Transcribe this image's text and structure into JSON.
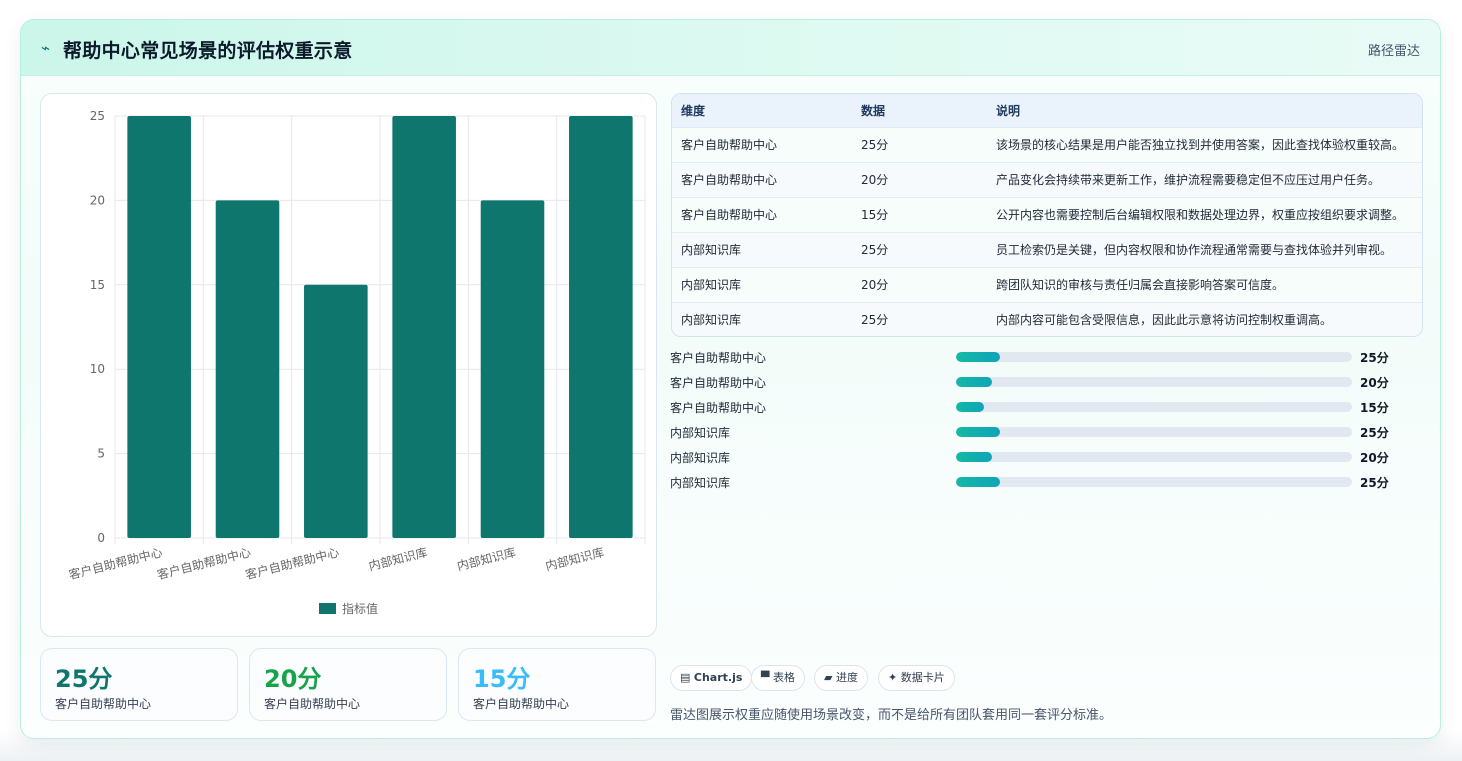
{
  "header": {
    "icon": "spark-icon",
    "title": "帮助中心常见场景的评估权重示意",
    "tag": "路径雷达"
  },
  "colors": {
    "bar": "#0f766e",
    "accent_green": "#16a34a",
    "accent_teal": "#0f766e",
    "accent_blue": "#38bdf8"
  },
  "chart_data": {
    "type": "bar",
    "categories": [
      "客户自助帮助中心",
      "客户自助帮助中心",
      "客户自助帮助中心",
      "内部知识库",
      "内部知识库",
      "内部知识库"
    ],
    "series": [
      {
        "name": "指标值",
        "values": [
          25,
          20,
          15,
          25,
          20,
          25
        ]
      }
    ],
    "ylim": [
      0,
      25
    ],
    "yticks": [
      0,
      5,
      10,
      15,
      20,
      25
    ],
    "grid": true,
    "legend": "bottom"
  },
  "table": {
    "headers": [
      "维度",
      "数据",
      "说明"
    ],
    "rows": [
      [
        "客户自助帮助中心",
        "25分",
        "该场景的核心结果是用户能否独立找到并使用答案，因此查找体验权重较高。"
      ],
      [
        "客户自助帮助中心",
        "20分",
        "产品变化会持续带来更新工作，维护流程需要稳定但不应压过用户任务。"
      ],
      [
        "客户自助帮助中心",
        "15分",
        "公开内容也需要控制后台编辑权限和数据处理边界，权重应按组织要求调整。"
      ],
      [
        "内部知识库",
        "25分",
        "员工检索仍是关键，但内容权限和协作流程通常需要与查找体验并列审视。"
      ],
      [
        "内部知识库",
        "20分",
        "跨团队知识的审核与责任归属会直接影响答案可信度。"
      ],
      [
        "内部知识库",
        "25分",
        "内部内容可能包含受限信息，因此此示意将访问控制权重调高。"
      ]
    ]
  },
  "progress": [
    {
      "label": "客户自助帮助中心",
      "value": "25分",
      "fraction": 0.11
    },
    {
      "label": "客户自助帮助中心",
      "value": "20分",
      "fraction": 0.09
    },
    {
      "label": "客户自助帮助中心",
      "value": "15分",
      "fraction": 0.07
    },
    {
      "label": "内部知识库",
      "value": "25分",
      "fraction": 0.11
    },
    {
      "label": "内部知识库",
      "value": "20分",
      "fraction": 0.09
    },
    {
      "label": "内部知识库",
      "value": "25分",
      "fraction": 0.11
    }
  ],
  "stats": [
    {
      "value": "25分",
      "label": "客户自助帮助中心",
      "color": "#0f766e"
    },
    {
      "value": "20分",
      "label": "客户自助帮助中心",
      "color": "#16a34a"
    },
    {
      "value": "15分",
      "label": "客户自助帮助中心",
      "color": "#38bdf8"
    }
  ],
  "chips": [
    {
      "icon": "chart-icon",
      "glyph": "▤",
      "label": "Chart.js"
    },
    {
      "icon": "table-icon",
      "glyph": "▀",
      "label": "表格"
    },
    {
      "icon": "progress-icon",
      "glyph": "▰",
      "label": "进度"
    },
    {
      "icon": "card-icon",
      "glyph": "✦",
      "label": "数据卡片"
    }
  ],
  "footnote": "雷达图展示权重应随使用场景改变，而不是给所有团队套用同一套评分标准。"
}
